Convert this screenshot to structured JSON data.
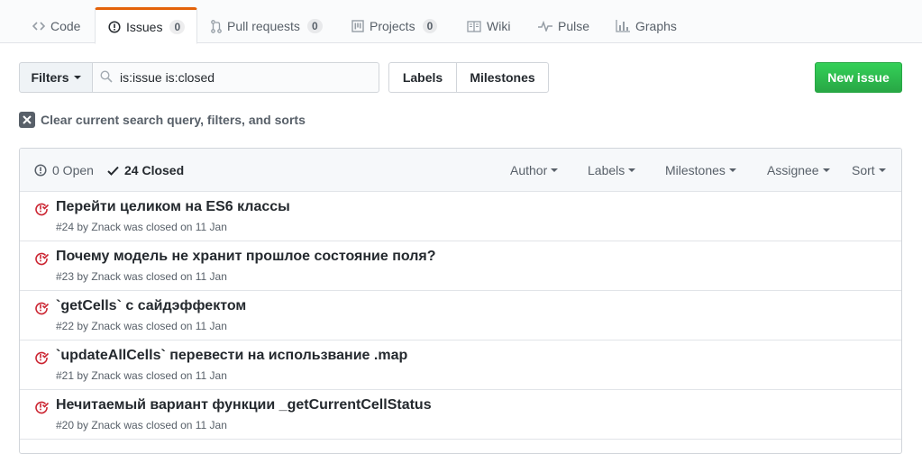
{
  "tabs": [
    {
      "label": "Code",
      "icon": "code-icon"
    },
    {
      "label": "Issues",
      "icon": "issue-opened-icon",
      "count": "0"
    },
    {
      "label": "Pull requests",
      "icon": "git-pull-request-icon",
      "count": "0"
    },
    {
      "label": "Projects",
      "icon": "project-icon",
      "count": "0"
    },
    {
      "label": "Wiki",
      "icon": "book-icon"
    },
    {
      "label": "Pulse",
      "icon": "pulse-icon"
    },
    {
      "label": "Graphs",
      "icon": "graph-icon"
    }
  ],
  "toolbar": {
    "filters_label": "Filters",
    "search_value": "is:issue is:closed",
    "labels_label": "Labels",
    "milestones_label": "Milestones",
    "new_issue_label": "New issue"
  },
  "clear_text": "Clear current search query, filters, and sorts",
  "header": {
    "open_text": "0 Open",
    "closed_text": "24 Closed",
    "filters": [
      "Author",
      "Labels",
      "Milestones",
      "Assignee",
      "Sort"
    ]
  },
  "issues": [
    {
      "title": "Перейти целиком на ES6 классы",
      "meta": "#24 by Znack was closed on 11 Jan"
    },
    {
      "title": "Почему модель не хранит прошлое состояние поля?",
      "meta": "#23 by Znack was closed on 11 Jan"
    },
    {
      "title": "`getCells` с сайдэффектом",
      "meta": "#22 by Znack was closed on 11 Jan"
    },
    {
      "title": "`updateAllCells` перевести на использвание .map",
      "meta": "#21 by Znack was closed on 11 Jan"
    },
    {
      "title": "Нечитаемый вариант функции _getCurrentCellStatus",
      "meta": "#20 by Znack was closed on 11 Jan"
    }
  ],
  "colors": {
    "accent": "#e36209",
    "closed": "#cb2431",
    "primary": "#28a745"
  }
}
